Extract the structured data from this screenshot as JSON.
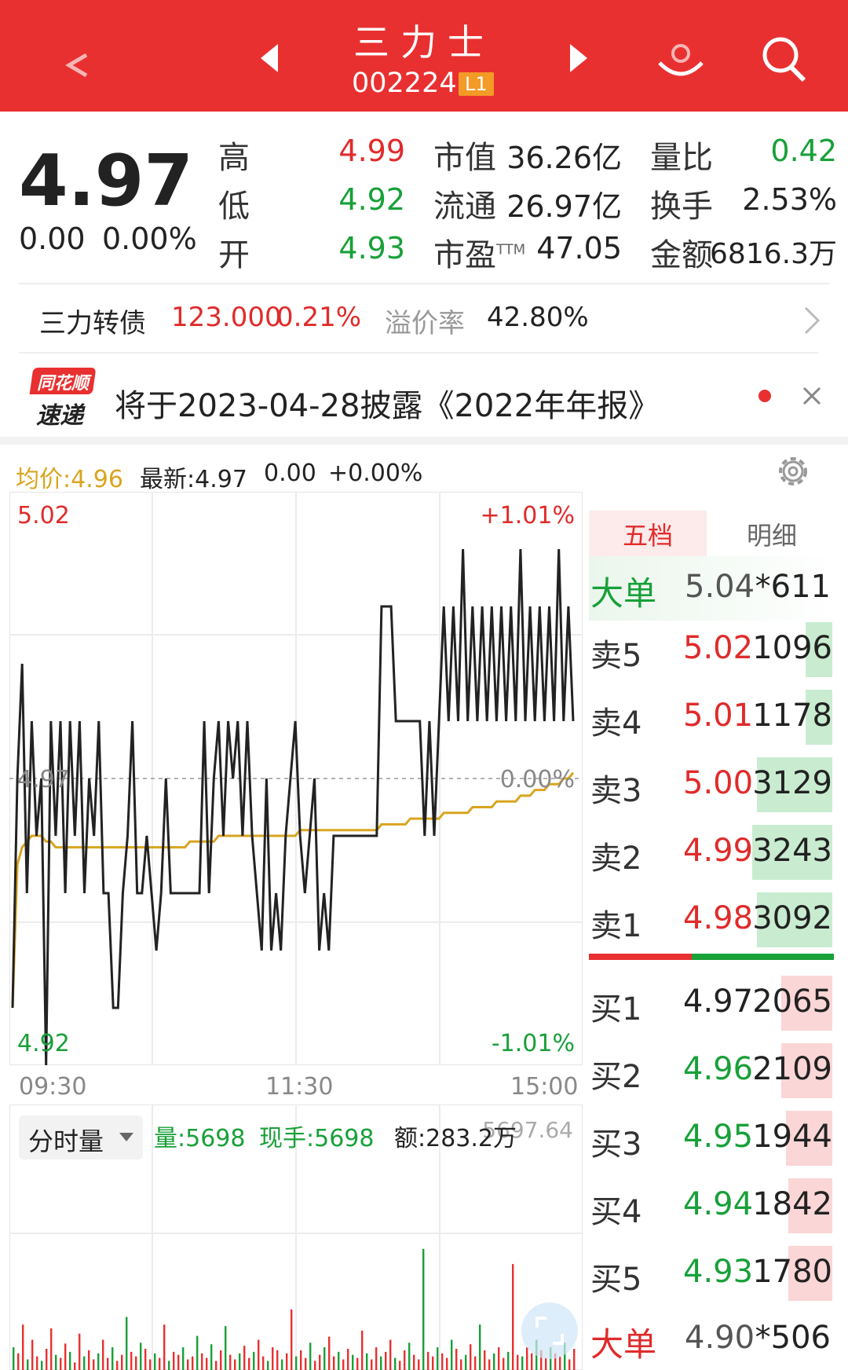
{
  "header": {
    "title": "三力士",
    "code": "002224",
    "level": "L1"
  },
  "quote": {
    "price": "4.97",
    "change": "0.00",
    "change_pct": "0.00%",
    "high_label": "高",
    "high": "4.99",
    "low_label": "低",
    "low": "4.92",
    "open_label": "开",
    "open": "4.93",
    "mktcap_label": "市值",
    "mktcap": "36.26亿",
    "float_label": "流通",
    "float": "26.97亿",
    "pe_label": "市盈",
    "pe_sup": "TTM",
    "pe": "47.05",
    "volratio_label": "量比",
    "volratio": "0.42",
    "turnover_label": "换手",
    "turnover": "2.53%",
    "amount_label": "金额",
    "amount": "6816.3万"
  },
  "bond": {
    "name": "三力转债",
    "price": "123.000",
    "pct": "0.21%",
    "premium_label": "溢价率",
    "premium": "42.80%"
  },
  "notice": {
    "logo_top": "同花顺",
    "logo_bottom": "速递",
    "text": "将于2023-04-28披露《2022年年报》"
  },
  "chart_stats": {
    "avg_label": "均价:4.96",
    "latest_label": "最新:4.97",
    "change": "0.00",
    "pct": "+0.00%"
  },
  "chart_data": {
    "type": "line",
    "price_axis": {
      "top": "5.02",
      "mid": "4.97",
      "bottom": "4.92"
    },
    "pct_axis": {
      "top": "+1.01%",
      "mid": "0.00%",
      "bottom": "-1.01%"
    },
    "x_ticks": [
      "09:30",
      "11:30",
      "15:00"
    ],
    "ylim": [
      4.92,
      5.02
    ],
    "series": [
      {
        "key": "price",
        "color": "#222222",
        "values": [
          4.93,
          4.97,
          4.99,
          4.95,
          4.98,
          4.96,
          4.97,
          4.92,
          4.98,
          4.96,
          4.98,
          4.95,
          4.98,
          4.96,
          4.98,
          4.95,
          4.97,
          4.96,
          4.98,
          4.95,
          4.95,
          4.93,
          4.93,
          4.95,
          4.96,
          4.98,
          4.95,
          4.95,
          4.96,
          4.95,
          4.94,
          4.95,
          4.97,
          4.95,
          4.95,
          4.95,
          4.95,
          4.95,
          4.95,
          4.95,
          4.98,
          4.95,
          4.97,
          4.98,
          4.96,
          4.98,
          4.97,
          4.98,
          4.96,
          4.98,
          4.96,
          4.95,
          4.94,
          4.97,
          4.94,
          4.95,
          4.94,
          4.96,
          4.97,
          4.98,
          4.96,
          4.95,
          4.96,
          4.97,
          4.94,
          4.95,
          4.94,
          4.96,
          4.96,
          4.96,
          4.96,
          4.96,
          4.96,
          4.96,
          4.96,
          4.96,
          4.96,
          5.0,
          5.0,
          5.0,
          4.98,
          4.98,
          4.98,
          4.98,
          4.98,
          4.98,
          4.96,
          4.98,
          4.96,
          4.98,
          5.0,
          4.98,
          5.0,
          4.98,
          5.01,
          4.98,
          5.0,
          4.98,
          5.0,
          4.98,
          5.0,
          4.98,
          5.0,
          4.98,
          5.0,
          4.98,
          5.01,
          4.98,
          5.0,
          4.98,
          5.0,
          4.98,
          5.0,
          4.98,
          5.01,
          4.98,
          5.0,
          4.98
        ]
      },
      {
        "key": "avg",
        "color": "#d9a520",
        "values": [
          4.93,
          4.955,
          4.958,
          4.959,
          4.96,
          4.96,
          4.96,
          4.959,
          4.959,
          4.958,
          4.958,
          4.958,
          4.958,
          4.958,
          4.958,
          4.958,
          4.958,
          4.958,
          4.958,
          4.958,
          4.958,
          4.958,
          4.958,
          4.958,
          4.958,
          4.958,
          4.958,
          4.958,
          4.958,
          4.958,
          4.958,
          4.958,
          4.958,
          4.958,
          4.958,
          4.958,
          4.958,
          4.959,
          4.959,
          4.959,
          4.959,
          4.959,
          4.959,
          4.96,
          4.96,
          4.96,
          4.96,
          4.96,
          4.96,
          4.96,
          4.96,
          4.96,
          4.96,
          4.96,
          4.96,
          4.96,
          4.96,
          4.96,
          4.96,
          4.96,
          4.961,
          4.961,
          4.961,
          4.961,
          4.961,
          4.961,
          4.961,
          4.961,
          4.961,
          4.961,
          4.961,
          4.961,
          4.961,
          4.961,
          4.961,
          4.961,
          4.961,
          4.962,
          4.962,
          4.962,
          4.962,
          4.962,
          4.962,
          4.963,
          4.963,
          4.963,
          4.963,
          4.963,
          4.963,
          4.963,
          4.964,
          4.964,
          4.964,
          4.964,
          4.964,
          4.964,
          4.965,
          4.965,
          4.965,
          4.965,
          4.965,
          4.966,
          4.966,
          4.966,
          4.966,
          4.966,
          4.967,
          4.967,
          4.967,
          4.968,
          4.968,
          4.968,
          4.969,
          4.969,
          4.969,
          4.97,
          4.97,
          4.971
        ]
      }
    ]
  },
  "volume": {
    "dropdown_label": "分时量",
    "vol_label": "量:5698",
    "hand_label": "现手:5698",
    "amount_label": "额:283.2万",
    "max_label": "5697.64",
    "bars": [
      30,
      22,
      60,
      14,
      40,
      18,
      12,
      28,
      55,
      20,
      16,
      35,
      24,
      10,
      48,
      18,
      26,
      14,
      22,
      40,
      16,
      30,
      12,
      20,
      70,
      24,
      18,
      36,
      28,
      14,
      22,
      16,
      60,
      12,
      24,
      20,
      30,
      14,
      18,
      45,
      22,
      16,
      34,
      12,
      26,
      58,
      20,
      14,
      22,
      32,
      16,
      24,
      40,
      18,
      12,
      30,
      26,
      14,
      22,
      80,
      18,
      26,
      16,
      36,
      12,
      20,
      30,
      44,
      18,
      24,
      14,
      28,
      20,
      16,
      52,
      22,
      14,
      30,
      18,
      24,
      40,
      16,
      12,
      26,
      36,
      20,
      14,
      160,
      24,
      18,
      30,
      22,
      16,
      40,
      28,
      14,
      20,
      34,
      18,
      60,
      26,
      14,
      22,
      30,
      16,
      24,
      140,
      20,
      18,
      30,
      22,
      40,
      26,
      16,
      30,
      22,
      18,
      36,
      14,
      28
    ]
  },
  "orderbook": {
    "tab_five": "五档",
    "tab_detail": "明细",
    "big_sell": {
      "label": "大单",
      "price": "5.04",
      "vol": "*611"
    },
    "sells": [
      {
        "label": "卖5",
        "price": "5.02",
        "vol": "1096",
        "bar": 0.11
      },
      {
        "label": "卖4",
        "price": "5.01",
        "vol": "1178",
        "bar": 0.11
      },
      {
        "label": "卖3",
        "price": "5.00",
        "vol": "3129",
        "bar": 0.31
      },
      {
        "label": "卖2",
        "price": "4.99",
        "vol": "3243",
        "bar": 0.33
      },
      {
        "label": "卖1",
        "price": "4.98",
        "vol": "3092",
        "bar": 0.31
      }
    ],
    "buys": [
      {
        "label": "买1",
        "price": "4.97",
        "vol": "2065",
        "bar": 0.21
      },
      {
        "label": "买2",
        "price": "4.96",
        "vol": "2109",
        "bar": 0.21
      },
      {
        "label": "买3",
        "price": "4.95",
        "vol": "1944",
        "bar": 0.19
      },
      {
        "label": "买4",
        "price": "4.94",
        "vol": "1842",
        "bar": 0.18
      },
      {
        "label": "买5",
        "price": "4.93",
        "vol": "1780",
        "bar": 0.18
      }
    ],
    "big_buy": {
      "label": "大单",
      "price": "4.90",
      "vol": "*506"
    }
  },
  "colors": {
    "red": "#e93030",
    "green": "#18a039",
    "avg_line": "#d9a520"
  }
}
